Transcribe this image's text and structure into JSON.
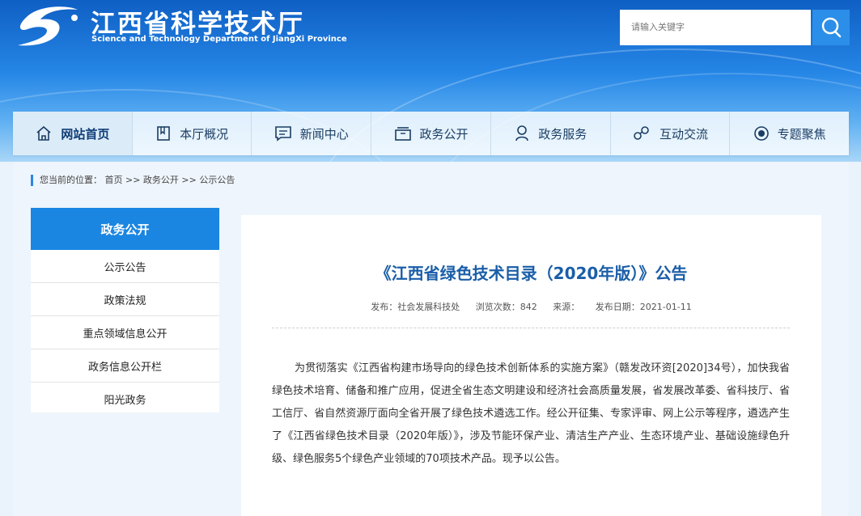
{
  "header": {
    "title": "江西省科学技术厅",
    "subtitle": "Science and Technology Department of JiangXi Province",
    "search_placeholder": "请输入关键字"
  },
  "nav": {
    "items": [
      {
        "label": "网站首页",
        "icon": "home-icon",
        "active": true
      },
      {
        "label": "本厅概况",
        "icon": "bookmark-icon",
        "active": false
      },
      {
        "label": "新闻中心",
        "icon": "message-icon",
        "active": false
      },
      {
        "label": "政务公开",
        "icon": "folder-icon",
        "active": false
      },
      {
        "label": "政务服务",
        "icon": "user-icon",
        "active": false
      },
      {
        "label": "互动交流",
        "icon": "chat-icon",
        "active": false
      },
      {
        "label": "专题聚焦",
        "icon": "target-icon",
        "active": false
      }
    ]
  },
  "breadcrumb": {
    "text": "您当前的位置： 首页 >> 政务公开 >> 公示公告"
  },
  "sidebar": {
    "title": "政务公开",
    "items": [
      "公示公告",
      "政策法规",
      "重点领域信息公开",
      "政务信息公开栏",
      "阳光政务"
    ]
  },
  "article": {
    "title": "《江西省绿色技术目录（2020年版）》公告",
    "publisher": "发布：社会发展科技处",
    "views": "浏览次数：842",
    "source": "来源：",
    "date": "发布日期：2021-01-11",
    "body": "为贯彻落实《江西省构建市场导向的绿色技术创新体系的实施方案》（赣发改环资[2020]34号），加快我省绿色技术培育、储备和推广应用，促进全省生态文明建设和经济社会高质量发展，省发展改革委、省科技厅、省工信厅、省自然资源厅面向全省开展了绿色技术遴选工作。经公开征集、专家评审、网上公示等程序，遴选产生了《江西省绿色技术目录（2020年版）》，涉及节能环保产业、清洁生产产业、生态环境产业、基础设施绿色升级、绿色服务5个绿色产业领域的70项技术产品。现予以公告。"
  },
  "colors": {
    "brand_blue": "#1a86e2",
    "title_blue": "#1a5ea8"
  }
}
